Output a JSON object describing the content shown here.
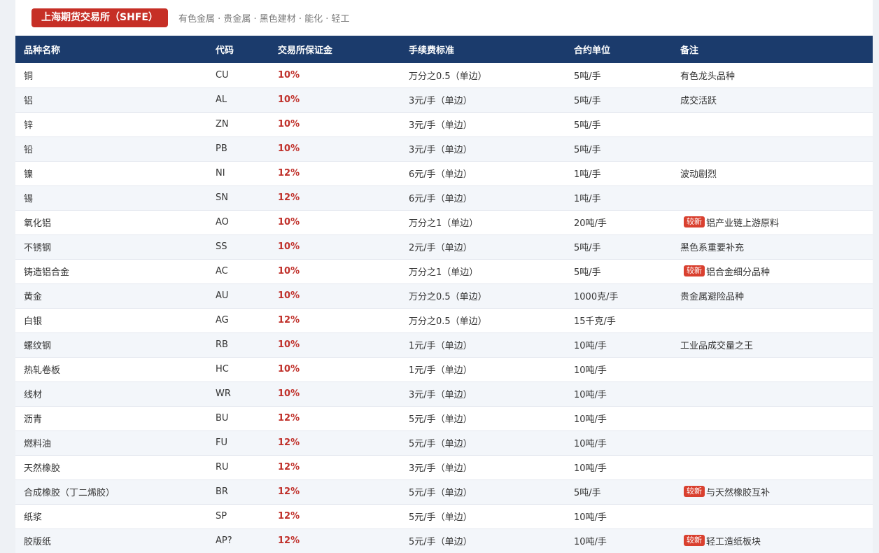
{
  "header": {
    "exchange": "上海期货交易所（SHFE）",
    "categories": "有色金属 · 贵金属 · 黑色建材 · 能化 · 轻工"
  },
  "table": {
    "columns": [
      "品种名称",
      "代码",
      "交易所保证金",
      "手续费标准",
      "合约单位",
      "备注"
    ],
    "new_badge_label": "较新",
    "rows": [
      {
        "name": "铜",
        "code": "CU",
        "margin": "10%",
        "fee": "万分之0.5（单边）",
        "unit": "5吨/手",
        "note": "有色龙头品种",
        "is_new": false
      },
      {
        "name": "铝",
        "code": "AL",
        "margin": "10%",
        "fee": "3元/手（单边）",
        "unit": "5吨/手",
        "note": "成交活跃",
        "is_new": false
      },
      {
        "name": "锌",
        "code": "ZN",
        "margin": "10%",
        "fee": "3元/手（单边）",
        "unit": "5吨/手",
        "note": "",
        "is_new": false
      },
      {
        "name": "铅",
        "code": "PB",
        "margin": "10%",
        "fee": "3元/手（单边）",
        "unit": "5吨/手",
        "note": "",
        "is_new": false
      },
      {
        "name": "镍",
        "code": "NI",
        "margin": "12%",
        "fee": "6元/手（单边）",
        "unit": "1吨/手",
        "note": "波动剧烈",
        "is_new": false
      },
      {
        "name": "锡",
        "code": "SN",
        "margin": "12%",
        "fee": "6元/手（单边）",
        "unit": "1吨/手",
        "note": "",
        "is_new": false
      },
      {
        "name": "氧化铝",
        "code": "AO",
        "margin": "10%",
        "fee": "万分之1（单边）",
        "unit": "20吨/手",
        "note": "铝产业链上游原料",
        "is_new": true
      },
      {
        "name": "不锈钢",
        "code": "SS",
        "margin": "10%",
        "fee": "2元/手（单边）",
        "unit": "5吨/手",
        "note": "黑色系重要补充",
        "is_new": false
      },
      {
        "name": "铸造铝合金",
        "code": "AC",
        "margin": "10%",
        "fee": "万分之1（单边）",
        "unit": "5吨/手",
        "note": "铝合金细分品种",
        "is_new": true
      },
      {
        "name": "黄金",
        "code": "AU",
        "margin": "10%",
        "fee": "万分之0.5（单边）",
        "unit": "1000克/手",
        "note": "贵金属避险品种",
        "is_new": false
      },
      {
        "name": "白银",
        "code": "AG",
        "margin": "12%",
        "fee": "万分之0.5（单边）",
        "unit": "15千克/手",
        "note": "",
        "is_new": false
      },
      {
        "name": "螺纹钢",
        "code": "RB",
        "margin": "10%",
        "fee": "1元/手（单边）",
        "unit": "10吨/手",
        "note": "工业品成交量之王",
        "is_new": false
      },
      {
        "name": "热轧卷板",
        "code": "HC",
        "margin": "10%",
        "fee": "1元/手（单边）",
        "unit": "10吨/手",
        "note": "",
        "is_new": false
      },
      {
        "name": "线材",
        "code": "WR",
        "margin": "10%",
        "fee": "3元/手（单边）",
        "unit": "10吨/手",
        "note": "",
        "is_new": false
      },
      {
        "name": "沥青",
        "code": "BU",
        "margin": "12%",
        "fee": "5元/手（单边）",
        "unit": "10吨/手",
        "note": "",
        "is_new": false
      },
      {
        "name": "燃料油",
        "code": "FU",
        "margin": "12%",
        "fee": "5元/手（单边）",
        "unit": "10吨/手",
        "note": "",
        "is_new": false
      },
      {
        "name": "天然橡胶",
        "code": "RU",
        "margin": "12%",
        "fee": "3元/手（单边）",
        "unit": "10吨/手",
        "note": "",
        "is_new": false
      },
      {
        "name": "合成橡胶（丁二烯胶）",
        "code": "BR",
        "margin": "12%",
        "fee": "5元/手（单边）",
        "unit": "5吨/手",
        "note": "与天然橡胶互补",
        "is_new": true
      },
      {
        "name": "纸浆",
        "code": "SP",
        "margin": "12%",
        "fee": "5元/手（单边）",
        "unit": "10吨/手",
        "note": "",
        "is_new": false
      },
      {
        "name": "胶版纸",
        "code": "AP?",
        "margin": "12%",
        "fee": "5元/手（单边）",
        "unit": "10吨/手",
        "note": "轻工造纸板块",
        "is_new": true
      }
    ]
  }
}
